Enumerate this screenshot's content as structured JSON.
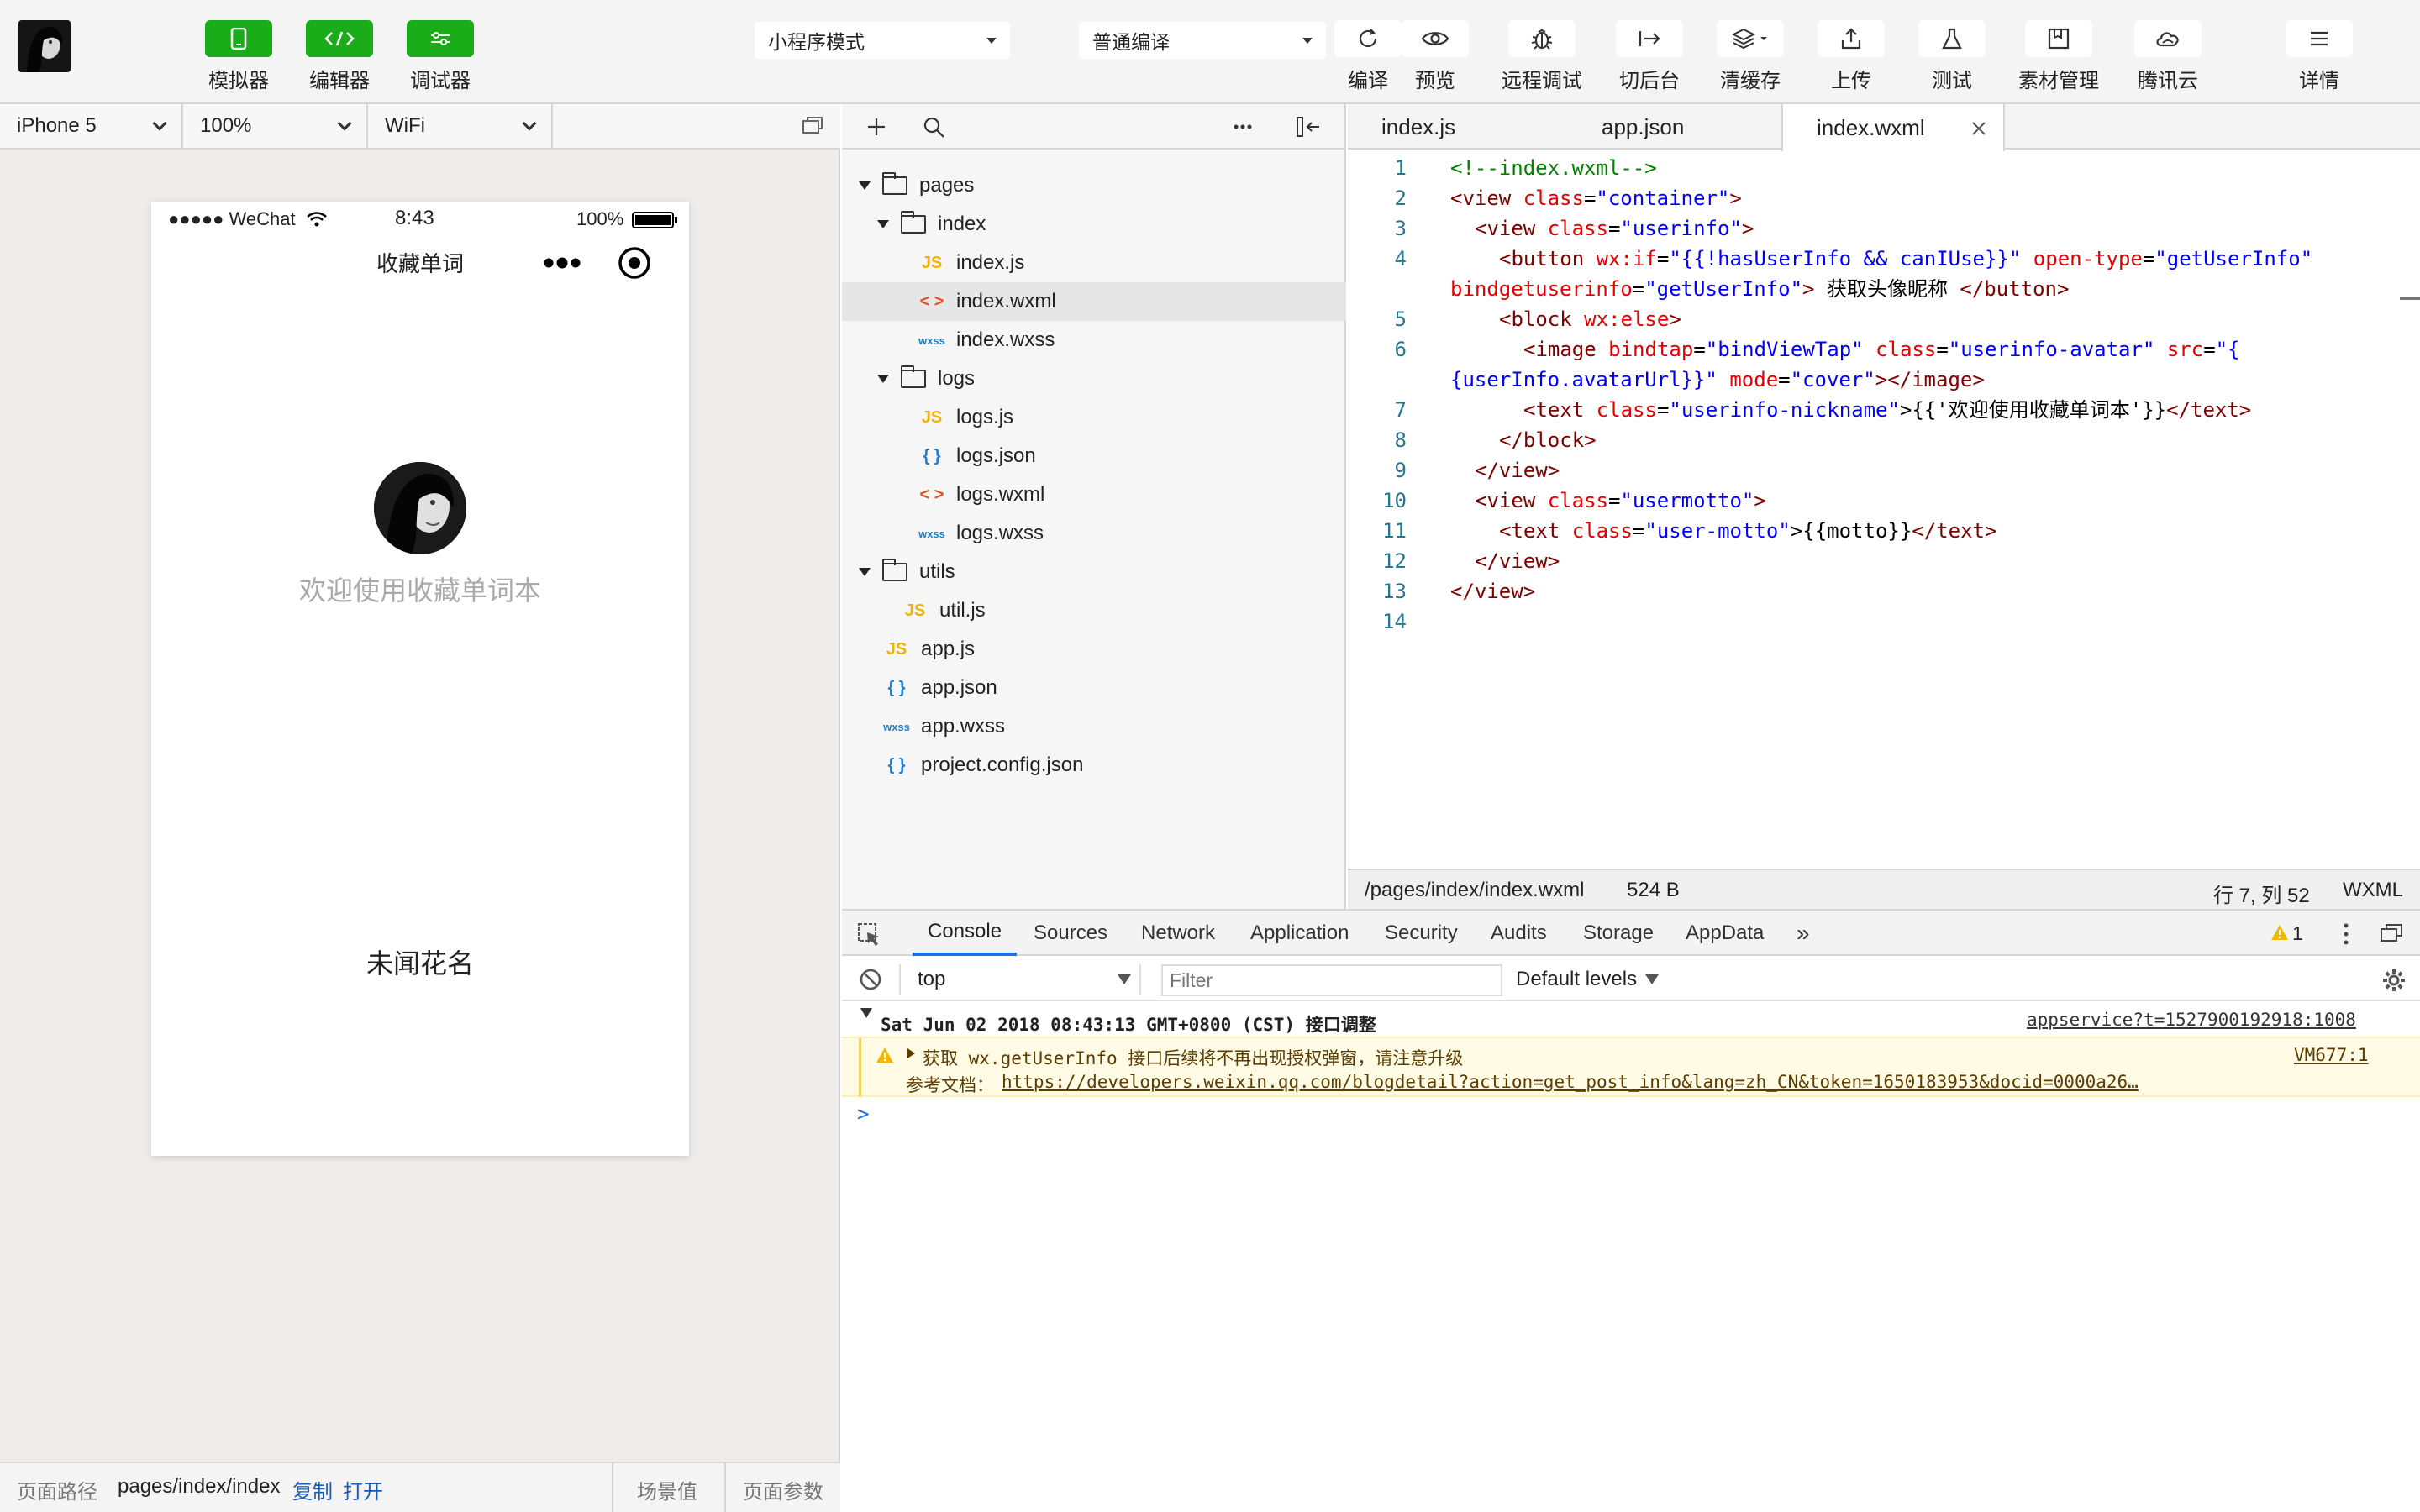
{
  "toolbar": {
    "simulator_label": "模拟器",
    "editor_label": "编辑器",
    "debugger_label": "调试器",
    "mode_select": "小程序模式",
    "compile_select": "普通编译",
    "compile_label": "编译",
    "preview_label": "预览",
    "remote_debug_label": "远程调试",
    "background_label": "切后台",
    "clear_cache_label": "清缓存",
    "upload_label": "上传",
    "test_label": "测试",
    "assets_label": "素材管理",
    "tencent_cloud_label": "腾讯云",
    "details_label": "详情"
  },
  "simulator": {
    "device": "iPhone 5",
    "zoom": "100%",
    "network": "WiFi",
    "status_carrier": "●●●●● WeChat",
    "status_time": "8:43",
    "status_battery": "100%",
    "nav_title": "收藏单词",
    "welcome_text": "欢迎使用收藏单词本",
    "motto": "未闻花名",
    "bottom": {
      "path_label": "页面路径",
      "path_value": "pages/index/index",
      "copy_label": "复制",
      "open_label": "打开",
      "scene_label": "场景值",
      "params_label": "页面参数"
    }
  },
  "tree": {
    "pages": "pages",
    "index": "index",
    "index_js": "index.js",
    "index_wxml": "index.wxml",
    "index_wxss": "index.wxss",
    "logs": "logs",
    "logs_js": "logs.js",
    "logs_json": "logs.json",
    "logs_wxml": "logs.wxml",
    "logs_wxss": "logs.wxss",
    "utils": "utils",
    "util_js": "util.js",
    "app_js": "app.js",
    "app_json": "app.json",
    "app_wxss": "app.wxss",
    "project_config": "project.config.json",
    "icon_js": "JS",
    "icon_wxml": "< >",
    "icon_json": "{ }",
    "icon_wxss": "wxss"
  },
  "editor": {
    "tabs": [
      "index.js",
      "app.json",
      "index.wxml"
    ],
    "line_numbers": [
      "1",
      "2",
      "3",
      "4",
      "5",
      "6",
      "7",
      "8",
      "9",
      "10",
      "11",
      "12",
      "13",
      "14"
    ],
    "status_path": "/pages/index/index.wxml",
    "status_size": "524 B",
    "status_position": "行 7, 列 52",
    "status_lang": "WXML"
  },
  "code": {
    "l1": "<!--index.wxml-->",
    "l2_open": "<view",
    "l2_attr": "class",
    "l2_val": "\"container\"",
    "l2_end": ">",
    "l3_open": "<view",
    "l3_attr": "class",
    "l3_val": "\"userinfo\"",
    "l3_end": ">",
    "l4_open": "<button",
    "l4_attr1": "wx:if",
    "l4_val1": "\"{{!hasUserInfo && canIUse}}\"",
    "l4_attr2": "open-type",
    "l4_val2": "\"getUserInfo\"",
    "l4b_attr": "bindgetuserinfo",
    "l4b_val": "\"getUserInfo\"",
    "l4b_text": " 获取头像昵称 ",
    "l4b_close": "</button>",
    "l5_open": "<block",
    "l5_attr": "wx:else",
    "l5_end": ">",
    "l6_open": "<image",
    "l6_attr1": "bindtap",
    "l6_val1": "\"bindViewTap\"",
    "l6_attr2": "class",
    "l6_val2": "\"userinfo-avatar\"",
    "l6_attr3": "src",
    "l6_val3a": "\"{",
    "l6b_val3b": "{userInfo.avatarUrl}}\"",
    "l6b_attr4": "mode",
    "l6b_val4": "\"cover\"",
    "l6b_end": "></image>",
    "l7_open": "<text",
    "l7_attr": "class",
    "l7_val": "\"userinfo-nickname\"",
    "l7_text": ">{{'欢迎使用收藏单词本'}}",
    "l7_close": "</text>",
    "l8": "</block>",
    "l9": "</view>",
    "l10_open": "<view",
    "l10_attr": "class",
    "l10_val": "\"usermotto\"",
    "l10_end": ">",
    "l11_open": "<text",
    "l11_attr": "class",
    "l11_val": "\"user-motto\"",
    "l11_text": ">{{motto}}",
    "l11_close": "</text>",
    "l12": "</view>",
    "l13": "</view>"
  },
  "devtools": {
    "tabs": [
      "Console",
      "Sources",
      "Network",
      "Application",
      "Security",
      "Audits",
      "Storage",
      "AppData"
    ],
    "warning_count": "1",
    "context": "top",
    "filter_placeholder": "Filter",
    "levels": "Default levels",
    "group_header": "Sat Jun 02 2018 08:43:13 GMT+0800 (CST) 接口调整",
    "group_source": "appservice?t=1527900192918:1008",
    "warn_text": "获取 wx.getUserInfo 接口后续将不再出现授权弹窗，请注意升级",
    "warn_source": "VM677:1",
    "doc_label": "参考文档：",
    "doc_link": "https://developers.weixin.qq.com/blogdetail?action=get_post_info&lang=zh_CN&token=1650183953&docid=0000a26…",
    "prompt": ">"
  },
  "colors": {
    "green": "#1aad19",
    "warn_bg": "#fffbe5",
    "warn_text": "#5c3c00",
    "link": "#1a5bb5"
  }
}
